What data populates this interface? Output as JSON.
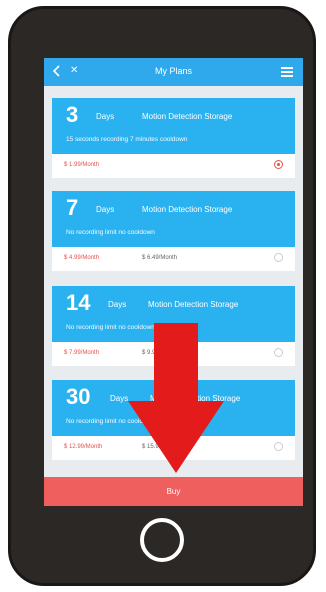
{
  "header": {
    "title": "My Plans"
  },
  "plans": [
    {
      "days": "3",
      "days_word": "Days",
      "storage": "Motion Detection Storage",
      "description": "15 seconds recording 7 minutes cooldown",
      "price": "$ 1.99/Month",
      "original": "",
      "selected": true
    },
    {
      "days": "7",
      "days_word": "Days",
      "storage": "Motion Detection Storage",
      "description": "No recording limit no cooldown",
      "price": "$ 4.99/Month",
      "original": "$ 6.49/Month",
      "selected": false
    },
    {
      "days": "14",
      "days_word": "Days",
      "storage": "Motion Detection Storage",
      "description": "No recording limit no cooldown",
      "price": "$ 7.99/Month",
      "original": "$ 9.99/Month",
      "selected": false
    },
    {
      "days": "30",
      "days_word": "Days",
      "storage": "Motion Detection Storage",
      "description": "No recording limit no cooldown",
      "price": "$ 12.99/Month",
      "original": "$ 15.99/Month",
      "selected": false
    }
  ],
  "buy_label": "Buy",
  "colors": {
    "accent": "#2ab2f0",
    "buy": "#ef5f5d",
    "arrow": "#e31b1b",
    "price": "#e8524b"
  }
}
